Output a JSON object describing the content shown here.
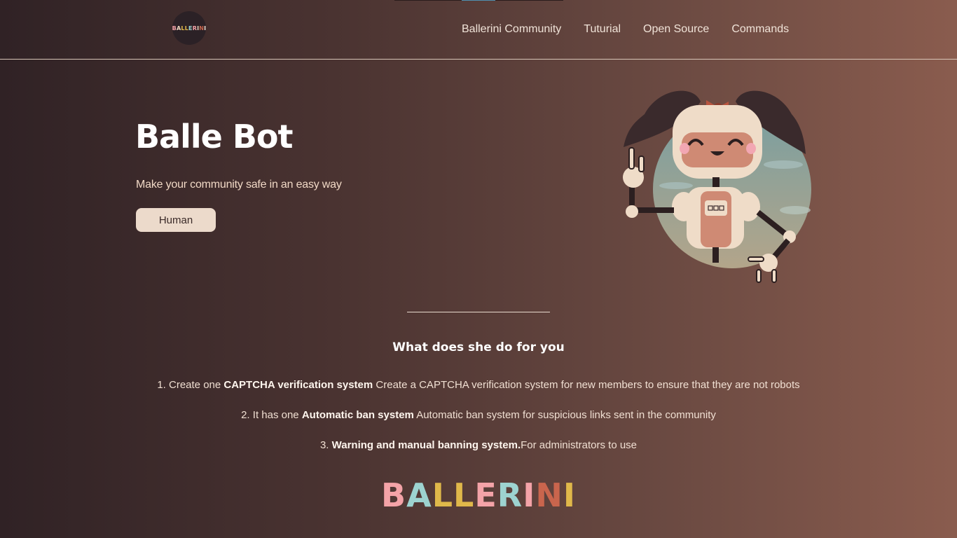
{
  "nav": {
    "logo_letters": [
      "B",
      "A",
      "L",
      "L",
      "E",
      "R",
      "I",
      "N",
      "I"
    ],
    "items": [
      "Ballerini Community",
      "Tuturial",
      "Open Source",
      "Commands"
    ]
  },
  "hero": {
    "title": "Balle Bot",
    "subtitle": "Make your community safe in an easy way",
    "button_label": "Human"
  },
  "section": {
    "title": "What does she do for you",
    "features": [
      {
        "prefix": "1. Create one ",
        "bold": "CAPTCHA verification system",
        "rest": " Create a CAPTCHA verification system for new members to ensure that they are not robots"
      },
      {
        "prefix": "2. It has one ",
        "bold": "Automatic ban system",
        "rest": " Automatic ban system for suspicious links sent in the community"
      },
      {
        "prefix": "3. ",
        "bold": "Warning and manual banning system.",
        "rest": "For administrators to use"
      }
    ]
  },
  "brand": {
    "letters": [
      "B",
      "A",
      "L",
      "L",
      "E",
      "R",
      "I",
      "N",
      "I"
    ],
    "colors": [
      "#f4a3a8",
      "#9dd3d0",
      "#e0b84a",
      "#e0b84a",
      "#f4a3a8",
      "#9dd3d0",
      "#f4a3a8",
      "#c9654d",
      "#e0b84a"
    ]
  },
  "colors": {
    "background_start": "#302225",
    "background_end": "#8a5c4e",
    "button_bg": "#ecdacb"
  }
}
